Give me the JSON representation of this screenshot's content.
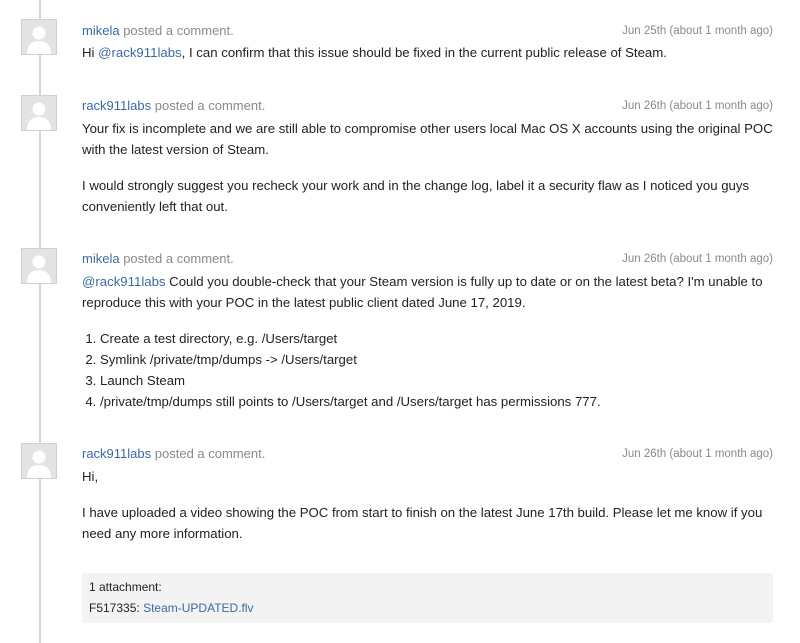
{
  "comments": [
    {
      "author": "mikela",
      "action": "posted a comment.",
      "timestamp": "Jun 25th (about 1 month ago)",
      "mention": "@rack911labs",
      "text_before": "Hi ",
      "text_after": ", I can confirm that this issue should be fixed in the current public release of Steam."
    },
    {
      "author": "rack911labs",
      "action": "posted a comment.",
      "timestamp": "Jun 26th (about 1 month ago)",
      "paragraphs": [
        "Your fix is incomplete and we are still able to compromise other users local Mac OS X accounts using the original POC with the latest version of Steam.",
        "I would strongly suggest you recheck your work and in the change log, label it a security flaw as I noticed you guys conveniently left that out."
      ]
    },
    {
      "author": "mikela",
      "action": "posted a comment.",
      "timestamp": "Jun 26th (about 1 month ago)",
      "mention": "@rack911labs",
      "text_after": " Could you double-check that your Steam version is fully up to date or on the latest beta? I'm unable to reproduce this with your POC in the latest public client dated June 17, 2019.",
      "steps": [
        "Create a test directory, e.g. /Users/target",
        "Symlink /private/tmp/dumps -> /Users/target",
        "Launch Steam",
        "/private/tmp/dumps still points to /Users/target and /Users/target has permissions 777."
      ]
    },
    {
      "author": "rack911labs",
      "action": "posted a comment.",
      "timestamp": "Jun 26th (about 1 month ago)",
      "paragraphs": [
        "Hi,",
        "I have uploaded a video showing the POC from start to finish on the latest June 17th build. Please let me know if you need any more information."
      ],
      "attachment": {
        "count_label": "1 attachment:",
        "file_id": "F517335:",
        "file_name": "Steam-UPDATED.flv"
      }
    }
  ],
  "icons": {
    "avatar": "user-silhouette-icon"
  }
}
